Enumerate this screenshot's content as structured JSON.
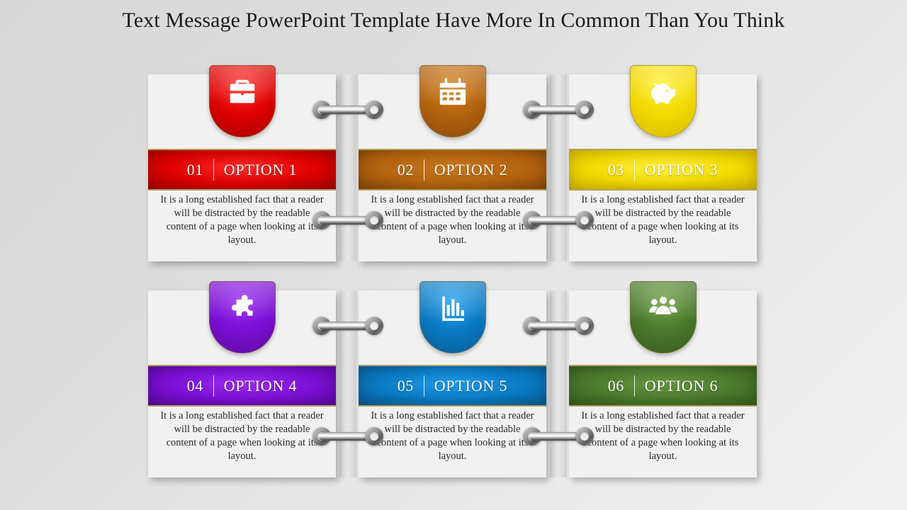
{
  "slide": {
    "title": "Text Message PowerPoint Template Have More In Common Than You Think",
    "background_from": "#d9d9d9",
    "background_to": "#f1f1f1"
  },
  "shared": {
    "body_text": "It is a long established fact that a reader will be distracted by the readable content of a page when looking at its layout.",
    "separator": "|"
  },
  "cards": [
    {
      "number": "01",
      "label": "OPTION 1",
      "icon": "briefcase-icon",
      "color": "#e00000",
      "color_light": "#ff2b2b",
      "color_dark": "#a60000",
      "body": "It is a long established fact that a reader will be distracted by the readable content of a page when looking at its layout."
    },
    {
      "number": "02",
      "label": "OPTION 2",
      "icon": "calendar-icon",
      "color": "#b5640f",
      "color_light": "#d4841f",
      "color_dark": "#8a4a08",
      "body": "It is a long established fact that a reader will be distracted by the readable content of a page when looking at its layout."
    },
    {
      "number": "03",
      "label": "OPTION 3",
      "icon": "piggy-bank-icon",
      "color": "#f2d900",
      "color_light": "#fff23d",
      "color_dark": "#d8bb00",
      "body": "It is a long established fact that a reader will be distracted by the readable content of a page when looking at its layout."
    },
    {
      "number": "04",
      "label": "OPTION 4",
      "icon": "puzzle-piece-icon",
      "color": "#7b0fd4",
      "color_light": "#9b2bf0",
      "color_dark": "#5c0aa0",
      "body": "It is a long established fact that a reader will be distracted by the readable content of a page when looking at its layout."
    },
    {
      "number": "05",
      "label": "OPTION 5",
      "icon": "bar-chart-icon",
      "color": "#0b7ac4",
      "color_light": "#1f9ae8",
      "color_dark": "#065b94",
      "body": "It is a long established fact that a reader will be distracted by the readable content of a page when looking at its layout."
    },
    {
      "number": "06",
      "label": "OPTION 6",
      "icon": "people-group-icon",
      "color": "#4b7a2c",
      "color_light": "#66973f",
      "color_dark": "#375c1f",
      "body": "It is a long established fact that a reader will be distracted by the readable content of a page when looking at its layout."
    }
  ],
  "connectors": [
    {
      "name": "connector-row1-left-top"
    },
    {
      "name": "connector-row1-right-top"
    },
    {
      "name": "connector-row1-left-bottom"
    },
    {
      "name": "connector-row1-right-bottom"
    },
    {
      "name": "connector-row2-left-top"
    },
    {
      "name": "connector-row2-right-top"
    },
    {
      "name": "connector-row2-left-bottom"
    },
    {
      "name": "connector-row2-right-bottom"
    }
  ]
}
